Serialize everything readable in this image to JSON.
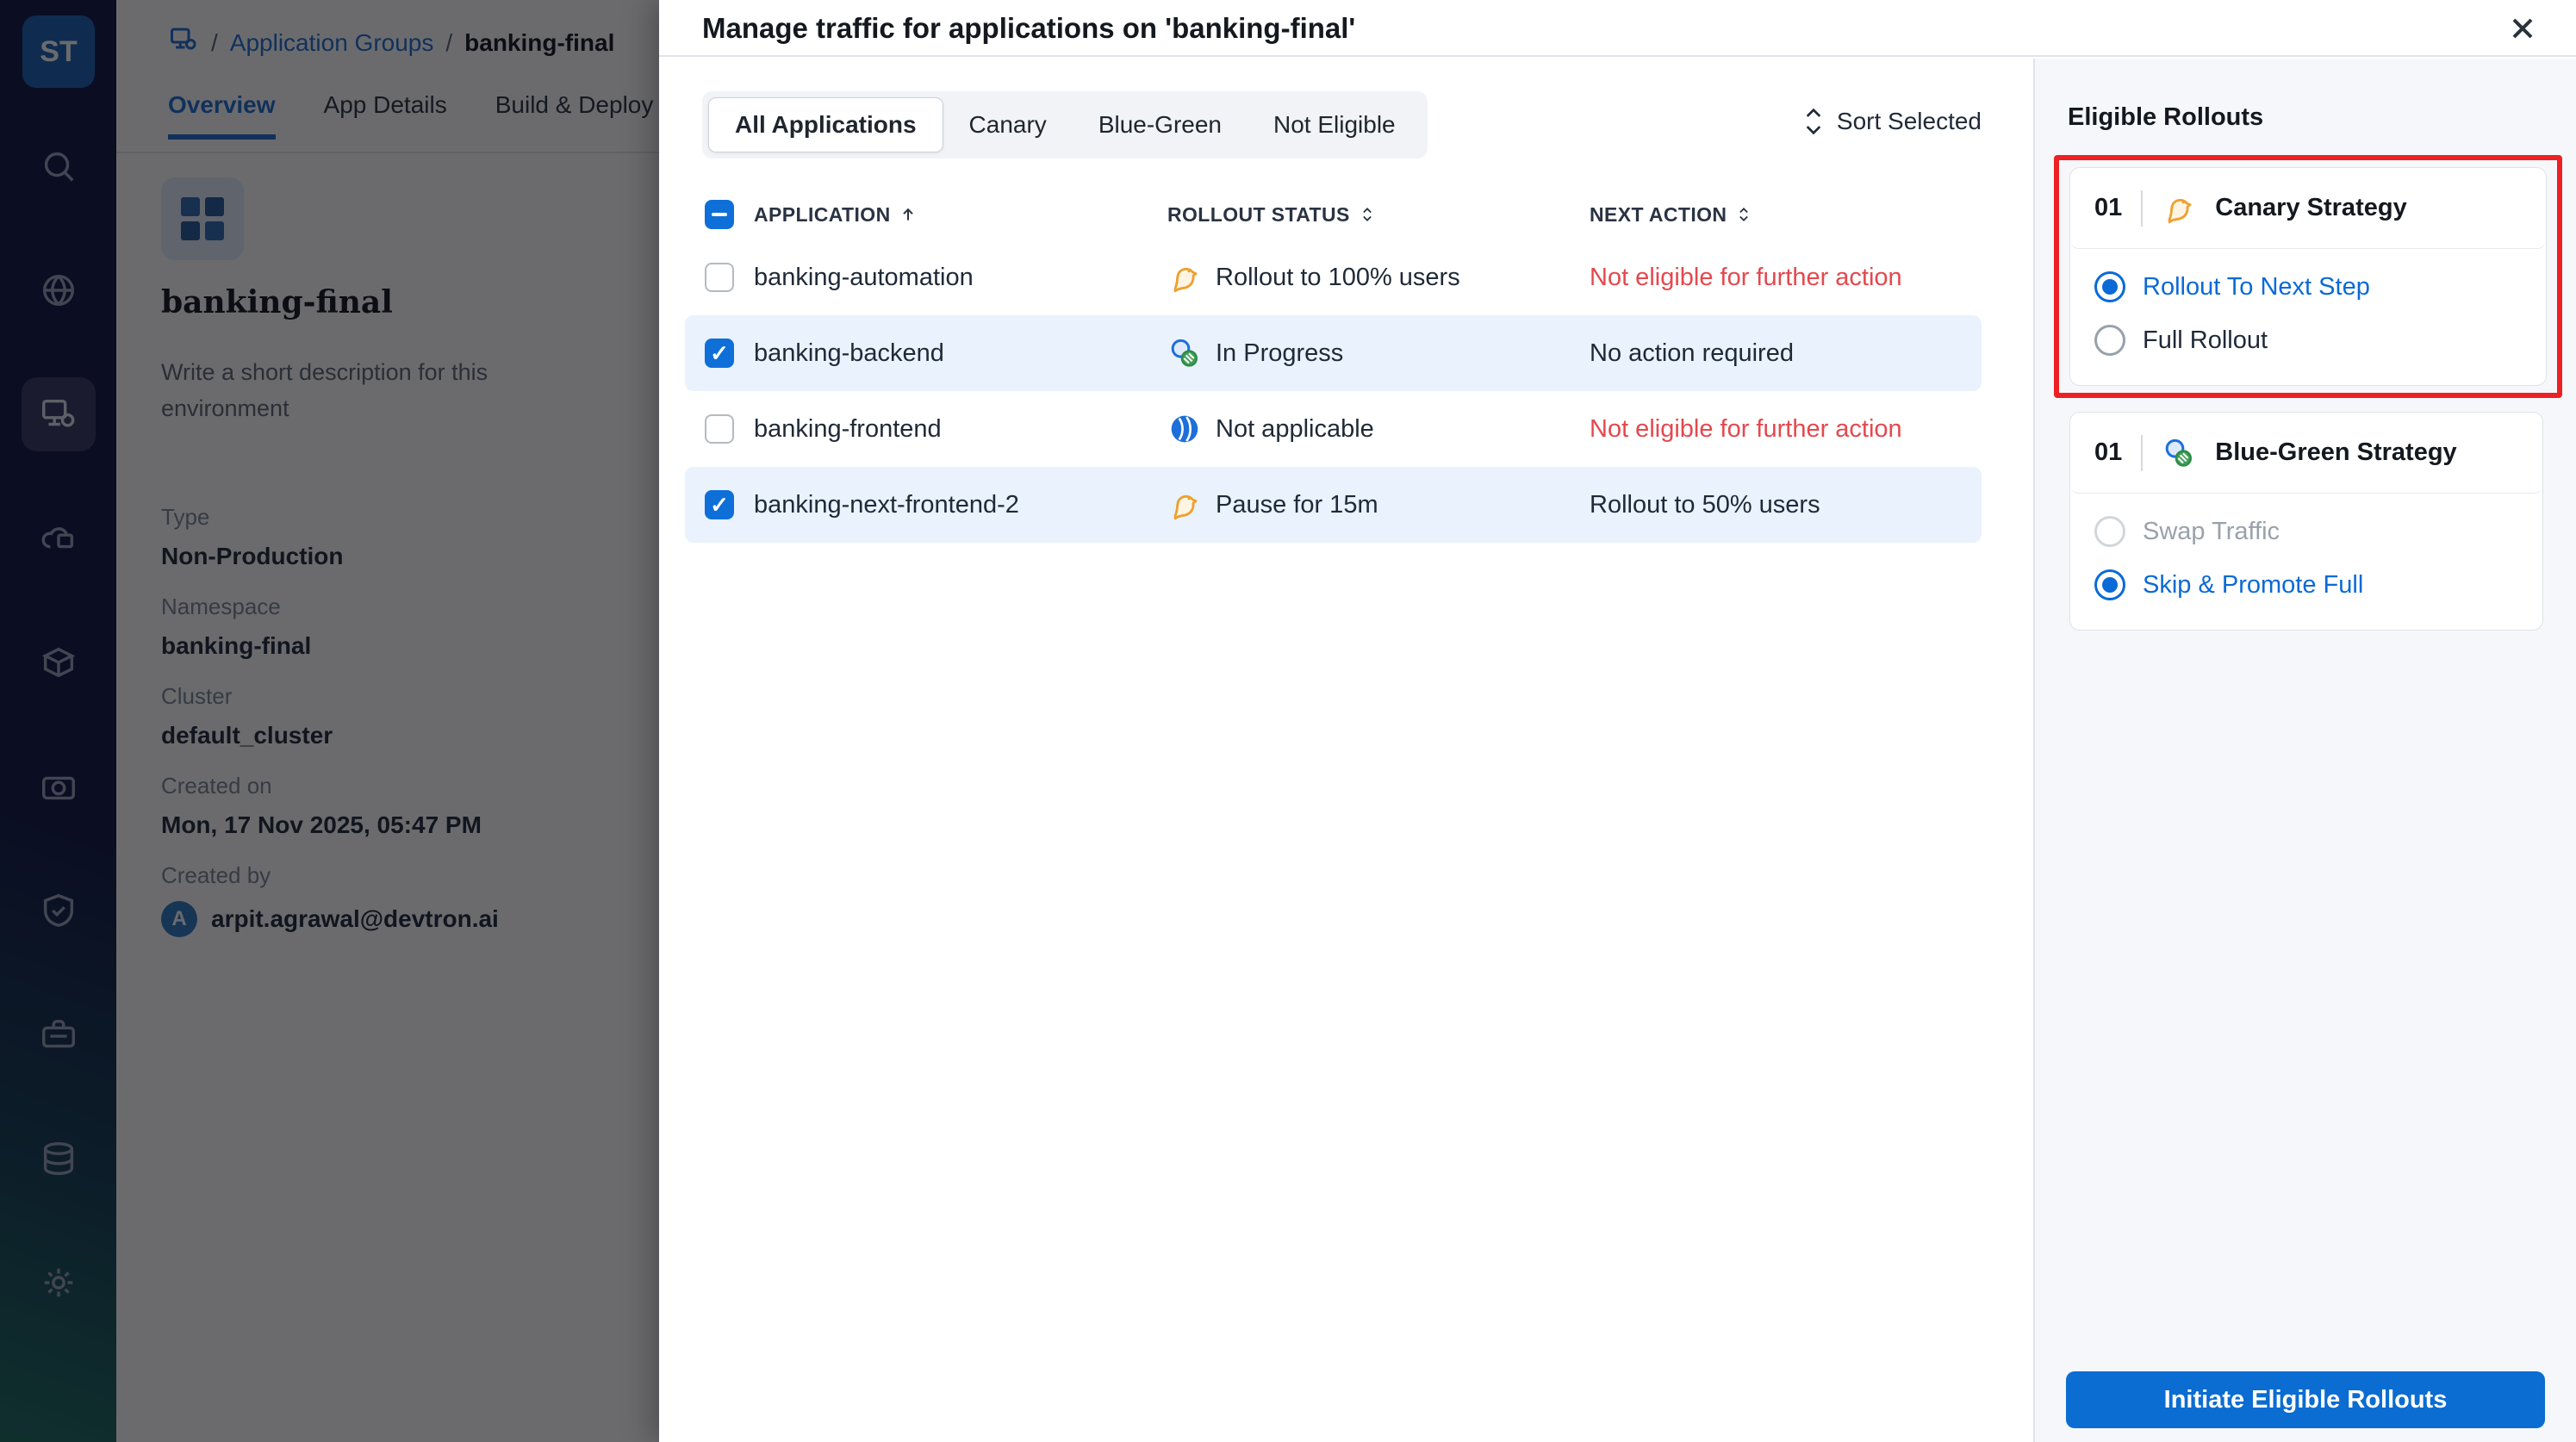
{
  "nav": {
    "logo_text": "ST",
    "items": [
      {
        "icon": "search-icon"
      },
      {
        "icon": "globe-icon"
      },
      {
        "icon": "application-groups-icon",
        "active": true
      },
      {
        "icon": "cloud-icon"
      },
      {
        "icon": "package-icon"
      },
      {
        "icon": "camera-icon"
      },
      {
        "icon": "shield-icon"
      },
      {
        "icon": "briefcase-icon"
      },
      {
        "icon": "stack-icon"
      },
      {
        "icon": "gear-icon"
      }
    ]
  },
  "breadcrumb": {
    "icon": "application-groups-icon",
    "sep1": "/",
    "link": "Application Groups",
    "sep2": "/",
    "current": "banking-final"
  },
  "background_tabs": {
    "items": [
      "Overview",
      "App Details",
      "Build & Deploy"
    ],
    "active": "Overview"
  },
  "environment": {
    "title": "banking-final",
    "description": "Write a short description for this environment",
    "fields": [
      {
        "label": "Type",
        "value": "Non-Production"
      },
      {
        "label": "Namespace",
        "value": "banking-final"
      },
      {
        "label": "Cluster",
        "value": "default_cluster"
      },
      {
        "label": "Created on",
        "value": "Mon, 17 Nov 2025, 05:47 PM"
      }
    ],
    "created_by_label": "Created by",
    "created_by": {
      "avatar_initial": "A",
      "email": "arpit.agrawal@devtron.ai"
    }
  },
  "modal": {
    "title": "Manage traffic for applications on 'banking-final'",
    "close_icon": "close-icon",
    "tabs": {
      "items": [
        "All Applications",
        "Canary",
        "Blue-Green",
        "Not Eligible"
      ],
      "active": "All Applications"
    },
    "sort_button": {
      "label": "Sort Selected",
      "icon": "sort-arrows-icon"
    },
    "table": {
      "header_checkbox_state": "indeterminate",
      "columns": [
        {
          "label": "APPLICATION",
          "sort_icon": "arrow-up-icon"
        },
        {
          "label": "ROLLOUT STATUS",
          "sort_icon": "sort-arrows-icon"
        },
        {
          "label": "NEXT ACTION",
          "sort_icon": "sort-arrows-icon"
        }
      ],
      "rows": [
        {
          "name": "banking-automation",
          "checked": false,
          "selected": false,
          "status": {
            "icon": "canary-icon",
            "label": "Rollout to 100% users"
          },
          "next_action": {
            "label": "Not eligible for further action",
            "tone": "danger"
          }
        },
        {
          "name": "banking-backend",
          "checked": true,
          "selected": true,
          "status": {
            "icon": "blue-green-icon",
            "label": "In Progress"
          },
          "next_action": {
            "label": "No action required",
            "tone": "normal"
          }
        },
        {
          "name": "banking-frontend",
          "checked": false,
          "selected": false,
          "status": {
            "icon": "not-applicable-icon",
            "label": "Not applicable"
          },
          "next_action": {
            "label": "Not eligible for further action",
            "tone": "danger"
          }
        },
        {
          "name": "banking-next-frontend-2",
          "checked": true,
          "selected": true,
          "status": {
            "icon": "canary-icon",
            "label": "Pause for 15m"
          },
          "next_action": {
            "label": "Rollout to 50% users",
            "tone": "normal"
          }
        }
      ]
    }
  },
  "rollouts_panel": {
    "title": "Eligible Rollouts",
    "strategies": [
      {
        "number": "01",
        "icon": "canary-icon",
        "name": "Canary Strategy",
        "highlighted": true,
        "options": [
          {
            "label": "Rollout To Next Step",
            "state": "selected"
          },
          {
            "label": "Full Rollout",
            "state": "unselected"
          }
        ]
      },
      {
        "number": "01",
        "icon": "blue-green-icon",
        "name": "Blue-Green Strategy",
        "highlighted": false,
        "options": [
          {
            "label": "Swap Traffic",
            "state": "disabled"
          },
          {
            "label": "Skip & Promote Full",
            "state": "selected"
          }
        ]
      }
    ],
    "action_button": "Initiate Eligible Rollouts"
  },
  "colors": {
    "accent_blue": "#0a6ad6",
    "danger_text": "#e5484d",
    "highlight_border": "#ed2024",
    "selected_row_bg": "#e9f2fd",
    "panel_bg": "#f5f7fa",
    "canary_orange": "#eda12f",
    "bluegreen_green": "#3fa055",
    "nav_bg": "#101442"
  }
}
